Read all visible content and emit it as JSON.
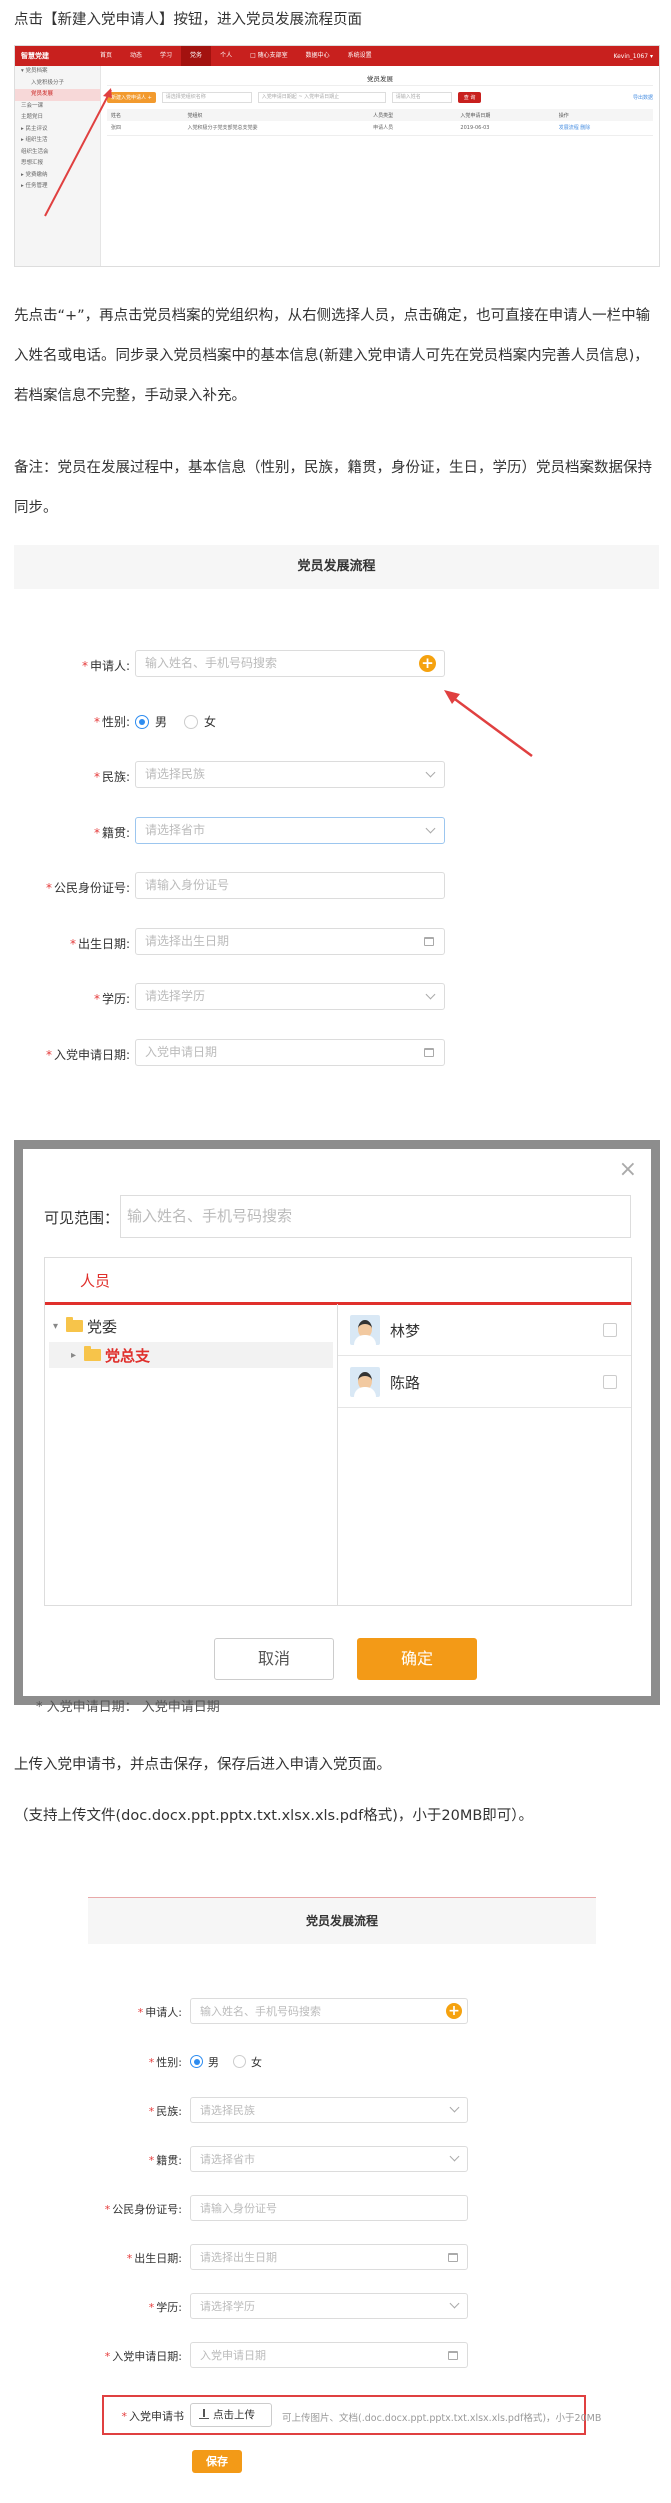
{
  "intro_text": "点击【新建入党申请人】按钮，进入党员发展流程页面",
  "para1": "先点击“+”，再点击党员档案的党组织构，从右侧选择人员，点击确定，也可直接在申请人一栏中输入姓名或电话。同步录入党员档案中的基本信息(新建入党申请人可先在党员档案内完善人员信息)，若档案信息不完整，手动录入补充。",
  "para2": "备注：党员在发展过程中，基本信息（性别，民族，籍贯，身份证，生日，学历）党员档案数据保持同步。",
  "para3": "上传入党申请书，并点击保存，保存后进入申请入党页面。",
  "para4": "（支持上传文件(doc.docx.ppt.pptx.txt.xlsx.xls.pdf格式)，小于20MB即可）。",
  "admin": {
    "logo": "智慧党建",
    "nav": [
      "首页",
      "动态",
      "学习",
      "党务",
      "个人",
      "□ 随心支部室",
      "数据中心",
      "系统设置"
    ],
    "user": "Kevin_1067 ▾",
    "sidebar": [
      {
        "label": "▾ 党员档案",
        "sub": false,
        "active": false
      },
      {
        "label": "入党积极分子",
        "sub": true,
        "active": false
      },
      {
        "label": "党员发展",
        "sub": true,
        "active": true
      },
      {
        "label": "三会一课",
        "sub": false,
        "active": false
      },
      {
        "label": "主题党日",
        "sub": false,
        "active": false
      },
      {
        "label": "▸ 民主评议",
        "sub": false,
        "active": false
      },
      {
        "label": "▸ 组织生活",
        "sub": false,
        "active": false
      },
      {
        "label": "组织生活会",
        "sub": false,
        "active": false
      },
      {
        "label": "思想汇报",
        "sub": false,
        "active": false
      },
      {
        "label": "▸ 党费缴纳",
        "sub": false,
        "active": false
      },
      {
        "label": "▸ 任务管理",
        "sub": false,
        "active": false
      }
    ],
    "page_title": "党员发展",
    "new_button": "新建入党申请人 +",
    "filter1": "请选择党组织名称",
    "filter2": "入党申请日期起 ~ 入党申请日期止",
    "filter3": "请输入姓名",
    "search_button": "查 询",
    "export_link": "导出数据",
    "columns": [
      "姓名",
      "党组织",
      "人员类型",
      "入党申请日期",
      "操作"
    ],
    "rows": [
      {
        "name": "张四",
        "org": "入党积极分子党支部党总支党委",
        "type": "申请人员",
        "date": "2019-06-03",
        "op_edit": "发展流程",
        "op_del": "删除"
      }
    ]
  },
  "flow_title": "党员发展流程",
  "form": {
    "applicant_label": "申请人:",
    "applicant_placeholder": "输入姓名、手机号码搜索",
    "plus_icon": "+",
    "gender_label": "性别:",
    "gender_male": "男",
    "gender_female": "女",
    "ethnic_label": "民族:",
    "ethnic_placeholder": "请选择民族",
    "native_label": "籍贯:",
    "native_placeholder": "请选择省市",
    "id_label": "公民身份证号:",
    "id_placeholder": "请输入身份证号",
    "birth_label": "出生日期:",
    "birth_placeholder": "请选择出生日期",
    "edu_label": "学历:",
    "edu_placeholder": "请选择学历",
    "apply_date_label": "入党申请日期:",
    "apply_date_placeholder": "入党申请日期",
    "letter_label": "入党申请书",
    "upload_button": "点击上传",
    "upload_hint": "可上传图片、文档(.doc.docx.ppt.pptx.txt.xlsx.xls.pdf格式)，小于20MB",
    "save_button": "保存"
  },
  "modal": {
    "close": "×",
    "scope_label": "可见范围：",
    "scope_placeholder": "输入姓名、手机号码搜索",
    "tab": "人员",
    "tree_root": "党委",
    "tree_child": "党总支",
    "people": [
      "林梦",
      "陈路"
    ],
    "cancel": "取消",
    "confirm": "确定",
    "behind_label": "* 入党申请日期：  入党申请日期"
  },
  "colors": {
    "primary_red": "#c8201e",
    "accent_orange": "#f39a17",
    "annotation_red": "#e04040",
    "select_blue": "#2d8cf0"
  }
}
